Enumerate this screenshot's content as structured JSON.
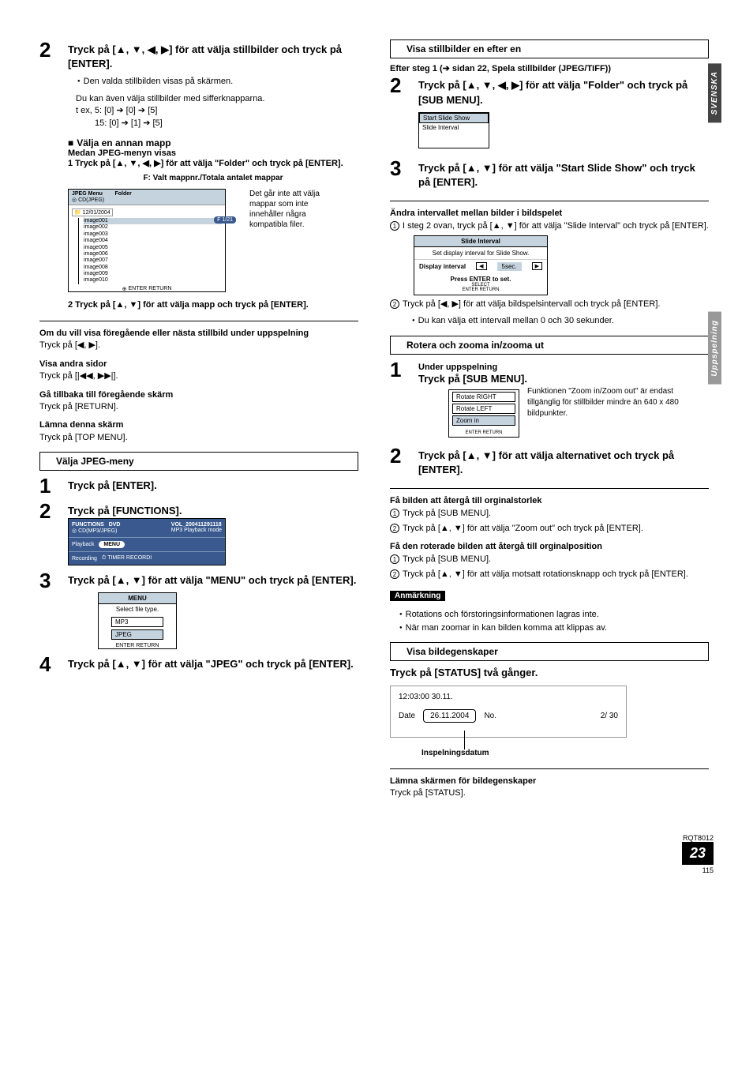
{
  "side": {
    "svenska": "SVENSKA",
    "uppspelning": "Uppspelning"
  },
  "left": {
    "step2": {
      "title": "Tryck på [▲, ▼, ◀, ▶] för att välja stillbilder och tryck på [ENTER].",
      "b1": "Den valda stillbilden visas på skärmen.",
      "b2": "Du kan även välja stillbilder med sifferknapparna.",
      "ex1": "t ex,    5:   [0] ➔ [0]  ➔ [5]",
      "ex2": "15:  [0] ➔ [1]  ➔ [5]"
    },
    "folder": {
      "h1": "Välja en annan mapp",
      "h2": "Medan JPEG-menyn visas",
      "s1": "1   Tryck på [▲, ▼, ◀, ▶] för att välja \"Folder\" och tryck på [ENTER].",
      "fLabel": "F:  Valt mappnr./Totala antalet mappar"
    },
    "jpegMenu": {
      "title": "JPEG Menu",
      "folder": "Folder",
      "disc": "CD(JPEG)",
      "date": "12/01/2004",
      "files": [
        "image001",
        "image002",
        "image003",
        "image004",
        "image005",
        "image006",
        "image007",
        "image008",
        "image009",
        "image010"
      ],
      "tab": "F  1/21",
      "enter": "ENTER",
      "return": "RETURN",
      "hint": "Det går inte att välja mappar som inte innehåller några kompatibla filer."
    },
    "folderStep2": "2   Tryck på [▲, ▼] för att välja mapp och tryck på [ENTER].",
    "tips": {
      "prevNextH": "Om du vill visa föregående eller nästa stillbild under uppspelning",
      "prevNext": "Tryck på [◀, ▶].",
      "otherH": "Visa andra sidor",
      "other": "Tryck på [|◀◀, ▶▶|].",
      "backH": "Gå tillbaka till föregående skärm",
      "back": "Tryck på [RETURN].",
      "leaveH": "Lämna denna skärm",
      "leave": "Tryck på [TOP MENU]."
    },
    "sectJpeg": "Välja JPEG-meny",
    "s1": "Tryck på [ENTER].",
    "s2": "Tryck på [FUNCTIONS].",
    "funcBox": {
      "functions": "FUNCTIONS",
      "dvd": "DVD",
      "cd": "CD(MP3/JPEG)",
      "vol": "VOL_200411291118",
      "mode": "MP3 Playback mode",
      "playback": "Playback",
      "menu": "MENU",
      "recording": "Recording",
      "timer": "TIMER RECORDI"
    },
    "s3": "Tryck på [▲, ▼] för att välja \"MENU\" och tryck på [ENTER].",
    "menuSel": {
      "hdr": "MENU",
      "txt": "Select file type.",
      "mp3": "MP3",
      "jpeg": "JPEG",
      "ret": "ENTER        RETURN"
    },
    "s4": "Tryck på [▲, ▼] för att välja \"JPEG\" och tryck på [ENTER]."
  },
  "right": {
    "box1": "Visa stillbilder en efter en",
    "after": "Efter steg 1 (➔ sidan 22, Spela stillbilder (JPEG/TIFF))",
    "step2": "Tryck på [▲, ▼, ◀, ▶] för att välja \"Folder\" och tryck på [SUB MENU].",
    "mini": {
      "start": "Start Slide Show",
      "interval": "Slide Interval"
    },
    "step3": "Tryck på [▲, ▼] för att välja \"Start Slide Show\" och tryck på [ENTER].",
    "changeH": "Ändra intervallet mellan bilder i bildspelet",
    "c1": "I steg 2 ovan, tryck på [▲, ▼] för att välja \"Slide Interval\" och tryck på [ENTER].",
    "slideInt": {
      "hdr": "Slide Interval",
      "txt": "Set display interval for Slide Show.",
      "disp": "Display interval",
      "val": "5sec.",
      "press": "Press ENTER to set.",
      "sel": "SELECT",
      "er": "ENTER       RETURN"
    },
    "c2": "Tryck på [◀, ▶] för att välja bildspelsintervall och tryck på [ENTER].",
    "c2b": "Du kan välja ett intervall mellan 0 och 30 sekunder.",
    "box2": "Rotera och zooma in/zooma ut",
    "r1h": "Under uppspelning",
    "r1": "Tryck på [SUB MENU].",
    "rotateBox": {
      "rr": "Rotate RIGHT",
      "rl": "Rotate LEFT",
      "zi": "Zoom in",
      "er": "ENTER\nRETURN"
    },
    "rotateNote": "Funktionen \"Zoom in/Zoom out\" är endast tillgänglig för stillbilder mindre än 640 x 480 bildpunkter.",
    "r2": "Tryck på [▲, ▼] för att välja alternativet och tryck på [ENTER].",
    "origH": "Få bilden att återgå till orginalstorlek",
    "orig1": "Tryck på [SUB MENU].",
    "orig2": "Tryck på [▲, ▼] för att välja \"Zoom out\" och tryck på [ENTER].",
    "rotH": "Få den roterade bilden att återgå till orginalposition",
    "rot1": "Tryck på [SUB MENU].",
    "rot2": "Tryck på [▲, ▼] för att välja motsatt rotationsknapp och tryck på [ENTER].",
    "note": "Anmärkning",
    "n1": "Rotations och förstoringsinformationen lagras inte.",
    "n2": "När man zoomar in kan bilden komma att klippas av.",
    "box3": "Visa bildegenskaper",
    "statusH": "Tryck på [STATUS] två gånger.",
    "status": {
      "time": "12:03:00  30.11.",
      "dateL": "Date",
      "date": "26.11.2004",
      "noL": "No.",
      "no": "2/  30",
      "rec": "Inspelningsdatum"
    },
    "leaveH": "Lämna skärmen för bildegenskaper",
    "leave": "Tryck på [STATUS]."
  },
  "footer": {
    "rq": "RQT8012",
    "pg": "23",
    "sub": "115"
  }
}
